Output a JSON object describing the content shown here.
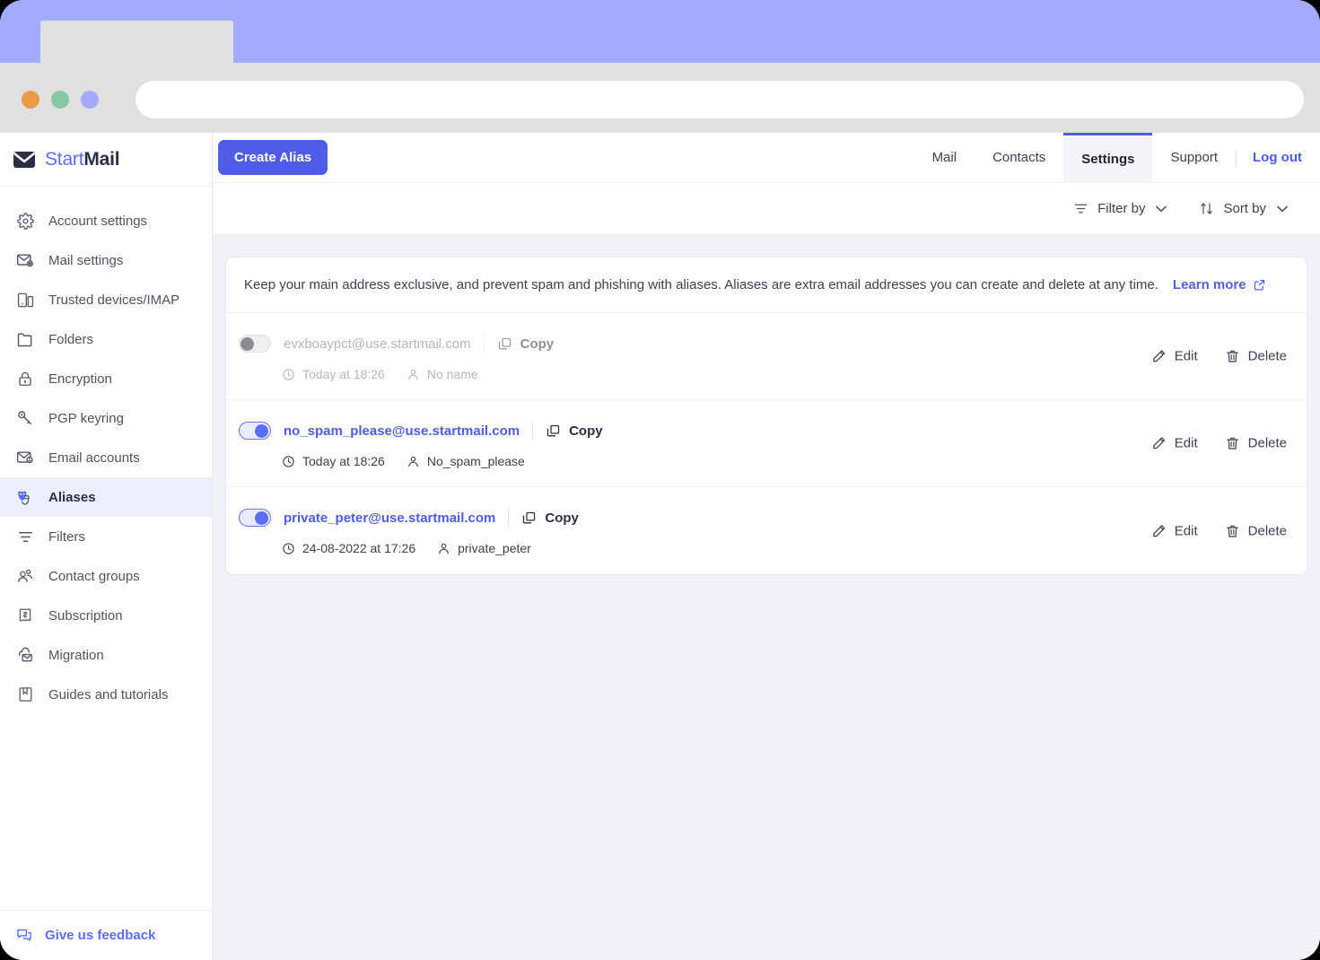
{
  "browser": {
    "dots": [
      "orange",
      "green",
      "purple"
    ],
    "url_value": "",
    "url_placeholder": ""
  },
  "brand": {
    "part1": "Start",
    "part2": "Mail",
    "icon": "envelope-icon"
  },
  "sidebar": {
    "items": [
      {
        "label": "Account settings",
        "icon": "gear-icon",
        "active": false
      },
      {
        "label": "Mail settings",
        "icon": "envelope-gear-icon",
        "active": false
      },
      {
        "label": "Trusted devices/IMAP",
        "icon": "devices-icon",
        "active": false
      },
      {
        "label": "Folders",
        "icon": "folder-icon",
        "active": false
      },
      {
        "label": "Encryption",
        "icon": "lock-icon",
        "active": false
      },
      {
        "label": "PGP keyring",
        "icon": "key-icon",
        "active": false
      },
      {
        "label": "Email accounts",
        "icon": "envelope-person-icon",
        "active": false
      },
      {
        "label": "Aliases",
        "icon": "masks-icon",
        "active": true
      },
      {
        "label": "Filters",
        "icon": "filter-icon",
        "active": false
      },
      {
        "label": "Contact groups",
        "icon": "people-icon",
        "active": false
      },
      {
        "label": "Subscription",
        "icon": "receipt-icon",
        "active": false
      },
      {
        "label": "Migration",
        "icon": "cloud-envelope-icon",
        "active": false
      },
      {
        "label": "Guides and tutorials",
        "icon": "book-icon",
        "active": false
      }
    ],
    "feedback": {
      "label": "Give us feedback",
      "icon": "chat-icon"
    }
  },
  "toolbar": {
    "create_label": "Create Alias",
    "nav": [
      {
        "label": "Mail",
        "active": false
      },
      {
        "label": "Contacts",
        "active": false
      },
      {
        "label": "Settings",
        "active": true
      },
      {
        "label": "Support",
        "active": false
      }
    ],
    "logout_label": "Log out"
  },
  "filterbar": {
    "filter_label": "Filter by",
    "sort_label": "Sort by",
    "caret": "⌄"
  },
  "banner": {
    "text": "Keep your main address exclusive, and prevent spam and phishing with aliases. Aliases are extra email addresses you can create and delete at any time.",
    "link_label": "Learn more",
    "link_icon": "external-link-icon"
  },
  "rows": [
    {
      "alias": "evxboaypct@use.startmail.com",
      "enabled": false,
      "copy_label": "Copy",
      "date": "Today at 18:26",
      "name": "No name",
      "edit_label": "Edit",
      "delete_label": "Delete"
    },
    {
      "alias": "no_spam_please@use.startmail.com",
      "enabled": true,
      "copy_label": "Copy",
      "date": "Today at 18:26",
      "name": "No_spam_please",
      "edit_label": "Edit",
      "delete_label": "Delete"
    },
    {
      "alias": "private_peter@use.startmail.com",
      "enabled": true,
      "copy_label": "Copy",
      "date": "24-08-2022 at 17:26",
      "name": "private_peter",
      "edit_label": "Edit",
      "delete_label": "Delete"
    }
  ],
  "colors": {
    "accent": "#4f5ce8",
    "chrome_band": "#a3abfd",
    "page_bg": "#f1f2f7",
    "sidebar_active": "#eceefd"
  }
}
